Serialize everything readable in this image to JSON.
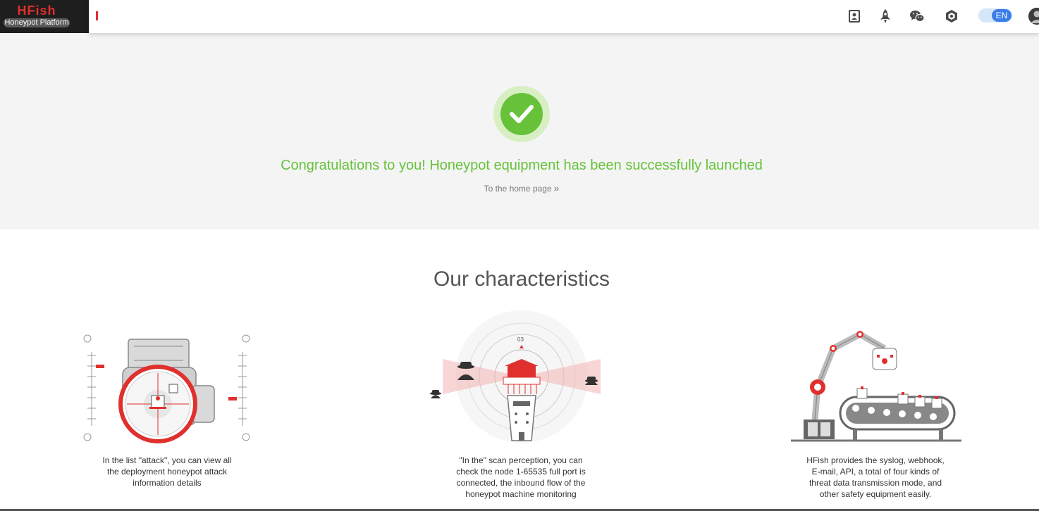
{
  "logo": {
    "title": "HFish",
    "subtitle": "Honeypot Platform"
  },
  "topbar": {
    "icons": [
      "contacts-book-icon",
      "rocket-icon",
      "wechat-icon",
      "hexagon-settings-icon"
    ],
    "language": "EN"
  },
  "hero": {
    "message": "Congratulations to you! Honeypot equipment has been successfully launched",
    "home_link": "To the home page",
    "home_link_icon": "»"
  },
  "characteristics": {
    "title": "Our characteristics",
    "items": [
      {
        "icon": "attack-gauge-illustration",
        "text": "In the list \"attack\", you can view all the deployment honeypot attack information details"
      },
      {
        "icon": "scan-tower-illustration",
        "text": "\"In the\" scan perception, you can check the node 1-65535 full port is connected, the inbound flow of the honeypot machine monitoring"
      },
      {
        "icon": "robot-arm-conveyor-illustration",
        "text": "HFish provides the syslog, webhook, E-mail, API, a total of four kinds of threat data transmission mode, and other safety equipment easily."
      }
    ]
  },
  "colors": {
    "accent_red": "#e0302e",
    "success_green": "#67c23a",
    "toggle_blue": "#3a7ee8"
  }
}
